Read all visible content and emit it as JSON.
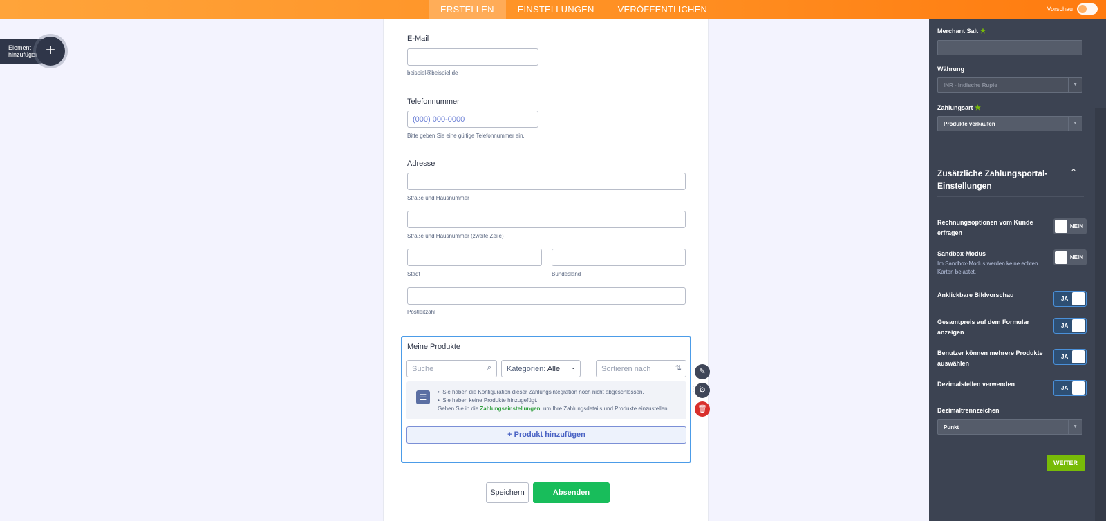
{
  "topbar": {
    "tabs": [
      "ERSTELLEN",
      "EINSTELLUNGEN",
      "VERÖFFENTLICHEN"
    ],
    "preview_label": "Vorschau"
  },
  "add_element": {
    "label_line1": "Element",
    "label_line2": "hinzufügen",
    "icon": "plus-icon"
  },
  "form": {
    "email": {
      "label": "E-Mail",
      "value": "",
      "sublabel": "beispiel@beispiel.de"
    },
    "phone": {
      "label": "Telefonnummer",
      "placeholder": "(000) 000-0000",
      "sublabel": "Bitte geben Sie eine gültige Telefonnummer ein."
    },
    "address": {
      "label": "Adresse",
      "street1_sub": "Straße und Hausnummer",
      "street2_sub": "Straße und Hausnummer (zweite Zeile)",
      "city_sub": "Stadt",
      "state_sub": "Bundesland",
      "zip_sub": "Postleitzahl"
    },
    "products": {
      "label": "Meine Produkte",
      "search_placeholder": "Suche",
      "category_label": "Kategorien:",
      "category_value": "Alle",
      "sort_placeholder": "Sortieren nach",
      "notice_line1": "Sie haben die Konfiguration dieser Zahlungsintegration noch nicht abgeschlossen.",
      "notice_line2": "Sie haben keine Produkte hinzugefügt.",
      "notice_line3_pre": "Gehen Sie in die",
      "notice_link": "Zahlungseinstellungen",
      "notice_line3_post": ", um Ihre Zahlungsdetails und Produkte einzustellen.",
      "add_button": "+ Produkt hinzufügen"
    },
    "save_button": "Speichern",
    "submit_button": "Absenden"
  },
  "panel": {
    "merchant_salt_label": "Merchant Salt",
    "merchant_salt_value": "",
    "currency_label": "Währung",
    "currency_value": "INR - Indische Rupie",
    "payment_type_label": "Zahlungsart",
    "payment_type_value": "Produkte verkaufen",
    "section_title": "Zusätzliche Zahlungsportal-Einstellungen",
    "rows": [
      {
        "label": "Rechnungsoptionen vom Kunde erfragen",
        "state": "NEIN"
      },
      {
        "label": "Sandbox-Modus",
        "desc": "Im Sandbox-Modus werden keine echten Karten belastet.",
        "state": "NEIN"
      },
      {
        "label": "Anklickbare Bildvorschau",
        "state": "JA"
      },
      {
        "label": "Gesamtpreis auf dem Formular anzeigen",
        "state": "JA"
      },
      {
        "label": "Benutzer können mehrere Produkte auswählen",
        "state": "JA"
      },
      {
        "label": "Dezimalstellen verwenden",
        "state": "JA"
      }
    ],
    "decimal_sep_label": "Dezimaltrennzeichen",
    "decimal_sep_value": "Punkt",
    "next_button": "WEITER"
  },
  "colors": {
    "accent": "#ff8f22",
    "submit": "#18bd5b",
    "panel": "#3c4352",
    "next": "#78bb07"
  }
}
